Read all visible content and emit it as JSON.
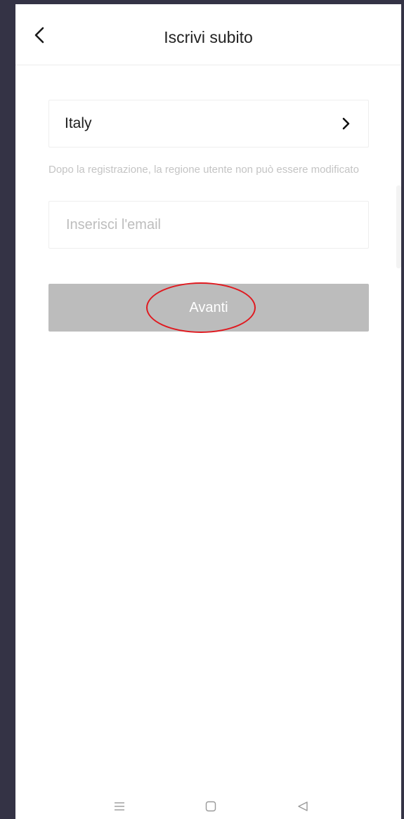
{
  "header": {
    "title": "Iscrivi subito",
    "back_icon": "chevron-left-icon"
  },
  "form": {
    "region": {
      "value": "Italy",
      "icon": "chevron-right-icon"
    },
    "region_note": "Dopo la registrazione, la regione utente non può essere modificato",
    "email": {
      "value": "",
      "placeholder": "Inserisci l'email"
    },
    "next_button": {
      "label": "Avanti",
      "state": "disabled"
    }
  },
  "annotation": {
    "highlight_color": "#e0191f"
  },
  "system_nav": {
    "items": [
      "menu-icon",
      "home-icon",
      "back-triangle-icon"
    ]
  },
  "colors": {
    "background_frame": "#343345",
    "button_disabled": "#bcbcbc",
    "hint_text": "#c4c4c4"
  }
}
